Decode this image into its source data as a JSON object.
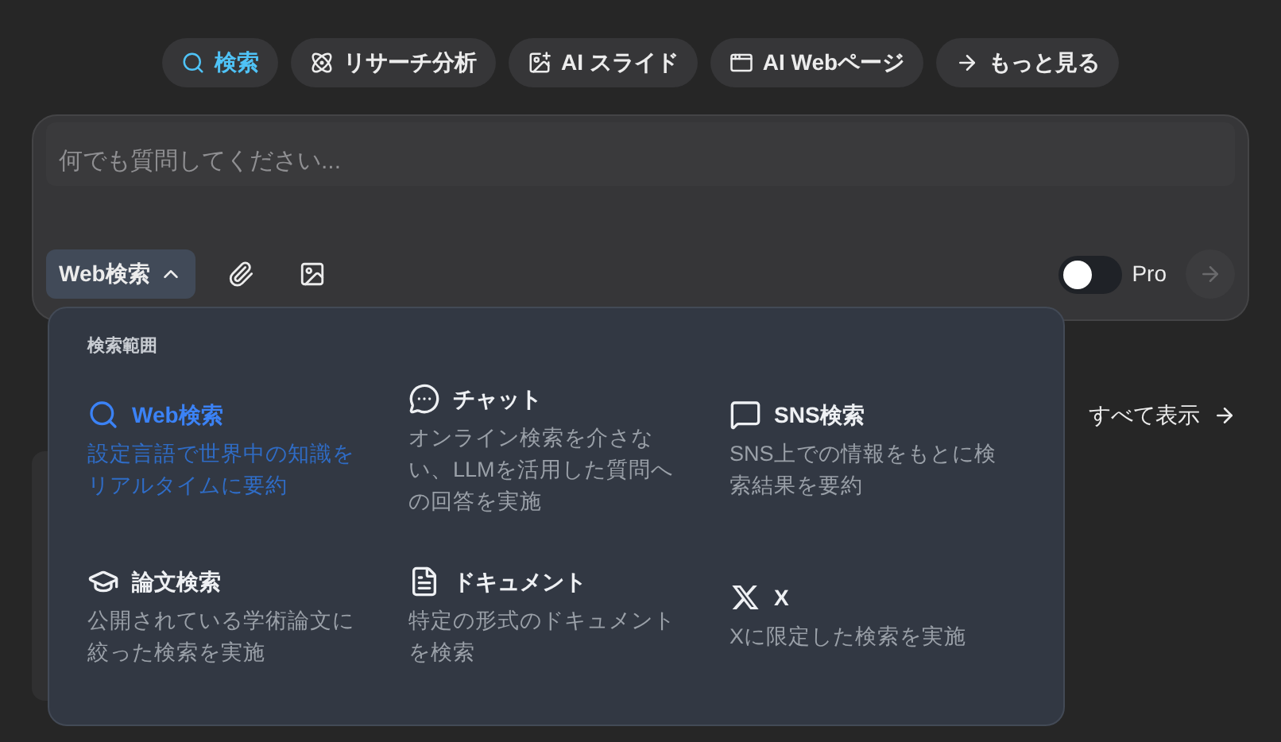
{
  "chips": [
    {
      "label": "検索",
      "kind": "search",
      "selected": true
    },
    {
      "label": "リサーチ分析",
      "kind": "research",
      "selected": false
    },
    {
      "label": "AI スライド",
      "kind": "slide",
      "selected": false
    },
    {
      "label": "AI Webページ",
      "kind": "webpage",
      "selected": false
    },
    {
      "label": "もっと見る",
      "kind": "more",
      "selected": false
    }
  ],
  "prompt": {
    "placeholder": "何でも質問してください...",
    "mode_button": {
      "label": "Web検索",
      "expanded": true
    },
    "pro_toggle": {
      "label": "Pro",
      "on": false
    }
  },
  "section": {
    "link": "すべて表示"
  },
  "dropdown": {
    "title": "検索範囲",
    "items": [
      {
        "kind": "web",
        "title": "Web検索",
        "description": "設定言語で世界中の知識をリアルタイムに要約",
        "selected": true
      },
      {
        "kind": "chat",
        "title": "チャット",
        "description": "オンライン検索を介さない、LLMを活用した質問への回答を実施",
        "selected": false
      },
      {
        "kind": "sns",
        "title": "SNS検索",
        "description": "SNS上での情報をもとに検索結果を要約",
        "selected": false
      },
      {
        "kind": "paper",
        "title": "論文検索",
        "description": "公開されている学術論文に絞った検索を実施",
        "selected": false
      },
      {
        "kind": "document",
        "title": "ドキュメント",
        "description": "特定の形式のドキュメントを検索",
        "selected": false
      },
      {
        "kind": "x",
        "title": "X",
        "description": "Xに限定した検索を実施",
        "selected": false
      }
    ]
  }
}
